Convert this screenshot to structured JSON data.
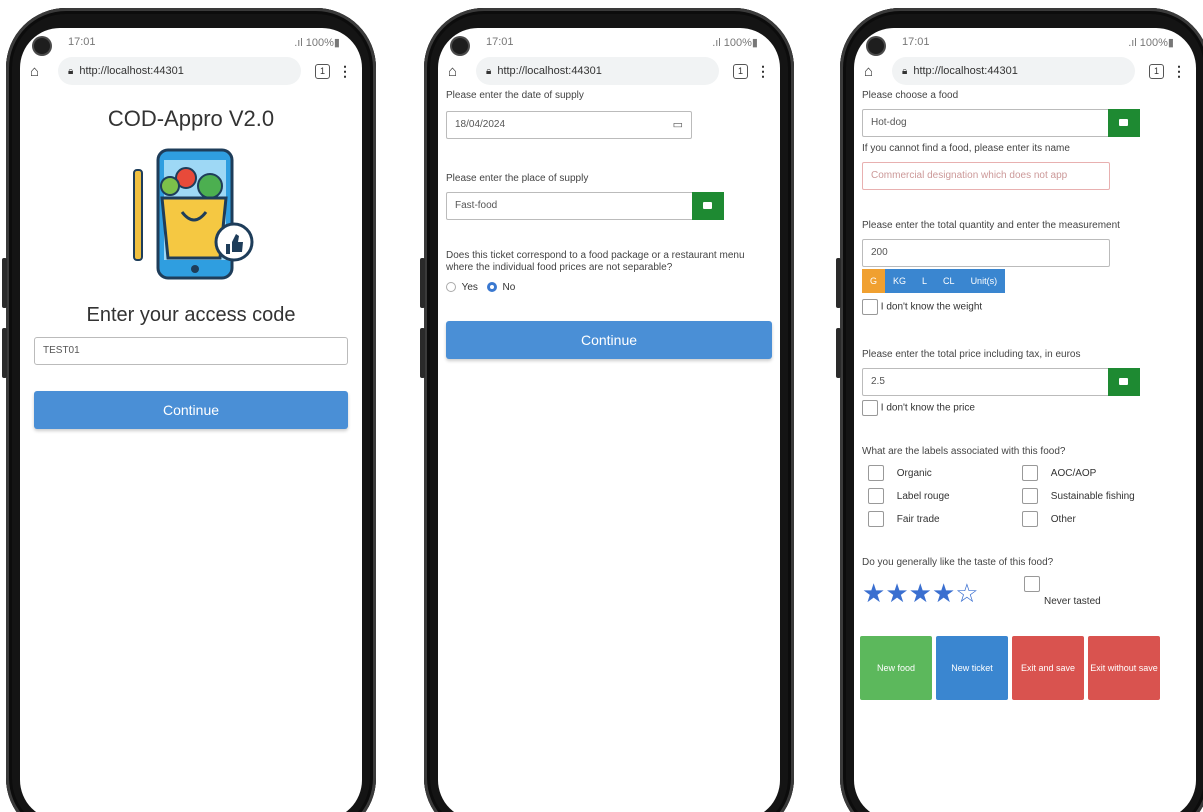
{
  "status": {
    "time": "17:01",
    "signal": ".ıl 100%▮"
  },
  "browser": {
    "url": "http://localhost:44301",
    "tabs_count": "1"
  },
  "screen1": {
    "app_title": "COD-Appro V2.0",
    "access_label": "Enter your access code",
    "access_code_value": "TEST01",
    "continue_label": "Continue"
  },
  "screen2": {
    "date_label": "Please enter the date of supply",
    "date_value": "18/04/2024",
    "place_label": "Please enter the place of supply",
    "place_value": "Fast-food",
    "package_question": "Does this ticket correspond to a food package or a restaurant menu where the individual food prices are not separable?",
    "yes_label": "Yes",
    "no_label": "No",
    "selected": "No",
    "continue_label": "Continue"
  },
  "screen3": {
    "food_label": "Please choose a food",
    "food_value": "Hot-dog",
    "food_name_label": "If you cannot find a food, please enter its name",
    "food_name_placeholder": "Commercial designation which does not app",
    "quantity_label": "Please enter the total quantity and enter the measurement",
    "quantity_value": "200",
    "units": [
      "G",
      "KG",
      "L",
      "CL",
      "Unit(s)"
    ],
    "selected_unit": "G",
    "unknown_weight_label": "I don't know the weight",
    "price_label": "Please enter the total price including tax, in euros",
    "price_value": "2.5",
    "unknown_price_label": "I don't know the price",
    "labels_question": "What are the labels associated with this food?",
    "labels_left": [
      "Organic",
      "Label rouge",
      "Fair trade"
    ],
    "labels_right": [
      "AOC/AOP",
      "Sustainable fishing",
      "Other"
    ],
    "taste_question": "Do you generally like the taste of this food?",
    "rating": 4,
    "rating_max": 5,
    "never_tasted_label": "Never tasted",
    "buttons": {
      "new_food": "New food",
      "new_ticket": "New ticket",
      "exit_save": "Exit and save",
      "exit_no_save": "Exit without save"
    }
  },
  "colors": {
    "primary": "#4a8fd6",
    "confirm_green": "#1e8a32",
    "unit_active": "#f0a030",
    "btn_green": "#5cb85c",
    "btn_blue": "#3a86d0",
    "btn_red": "#d9534f"
  }
}
